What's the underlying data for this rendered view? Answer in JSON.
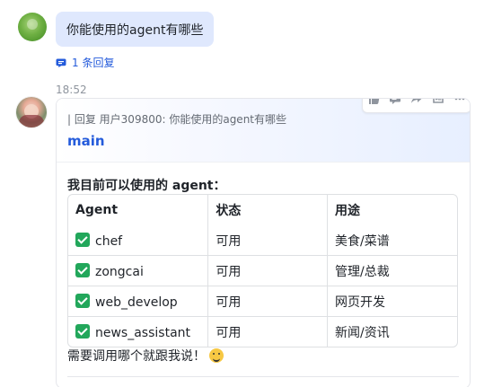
{
  "messages": {
    "user": {
      "text": "你能使用的agent有哪些",
      "replies_label": "1 条回复"
    },
    "bot": {
      "time": "18:52",
      "reply_quote": "| 回复 用户309800:  你能使用的agent有哪些",
      "title": "main",
      "intro": "我目前可以使用的 agent：",
      "table": {
        "headers": [
          "Agent",
          "状态",
          "用途"
        ],
        "rows": [
          [
            "chef",
            "可用",
            "美食/菜谱"
          ],
          [
            "zongcai",
            "可用",
            "管理/总裁"
          ],
          [
            "web_develop",
            "可用",
            "网页开发"
          ],
          [
            "news_assistant",
            "可用",
            "新闻/资讯"
          ]
        ]
      },
      "footer": "需要调用哪个就跟我说！"
    }
  },
  "icons": {
    "reply_count": "comment-bubble-icon",
    "toolbar": [
      "thumbs-up-icon",
      "reply-icon",
      "forward-icon",
      "quote-icon",
      "more-icon"
    ],
    "status_ok": "check-mark-icon",
    "footer_emoji": "smile-emoji-icon"
  },
  "colors": {
    "link_blue": "#245bdb",
    "user_bubble": "#dfe8fd",
    "border": "#dee0e3",
    "check_green": "#22a75b"
  }
}
